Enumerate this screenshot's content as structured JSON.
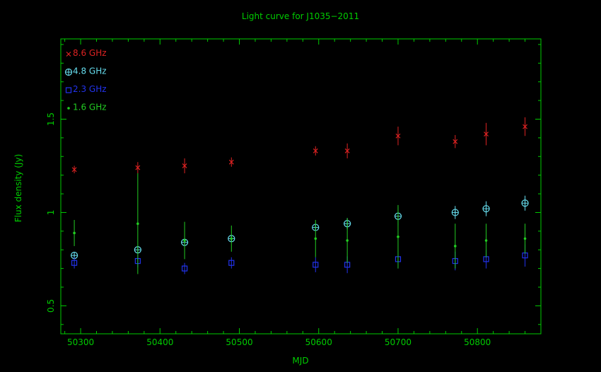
{
  "chart_data": {
    "type": "scatter",
    "title": "Light curve for J1035−2011",
    "xlabel": "MJD",
    "ylabel": "Flux density (Jy)",
    "xlim": [
      50275,
      50880
    ],
    "ylim": [
      0.35,
      1.93
    ],
    "xticks": [
      50300,
      50400,
      50500,
      50600,
      50700,
      50800
    ],
    "xtick_labels": [
      "50300",
      "50400",
      "50500",
      "50600",
      "50700",
      "50800"
    ],
    "yticks": [
      0.5,
      1,
      1.5
    ],
    "ytick_labels": [
      "0.5",
      "1",
      "1.5"
    ],
    "grid": false,
    "legend_position": "top-left",
    "axis_color": "#00cc00",
    "series": [
      {
        "name": "8.6 GHz",
        "marker": "x",
        "color": "#dd2222",
        "points": [
          {
            "x": 50292,
            "y": 1.23,
            "err": 0.02
          },
          {
            "x": 50372,
            "y": 1.24,
            "err": 0.03
          },
          {
            "x": 50431,
            "y": 1.25,
            "err": 0.04
          },
          {
            "x": 50490,
            "y": 1.27,
            "err": 0.025
          },
          {
            "x": 50596,
            "y": 1.33,
            "err": 0.025
          },
          {
            "x": 50636,
            "y": 1.33,
            "err": 0.04
          },
          {
            "x": 50700,
            "y": 1.41,
            "err": 0.05
          },
          {
            "x": 50772,
            "y": 1.38,
            "err": 0.035
          },
          {
            "x": 50811,
            "y": 1.42,
            "err": 0.06
          },
          {
            "x": 50860,
            "y": 1.46,
            "err": 0.05
          }
        ]
      },
      {
        "name": "4.8 GHz",
        "marker": "circle-plus",
        "color": "#66ddee",
        "points": [
          {
            "x": 50292,
            "y": 0.77,
            "err": 0.01
          },
          {
            "x": 50372,
            "y": 0.8,
            "err": 0.02
          },
          {
            "x": 50431,
            "y": 0.84,
            "err": 0.015
          },
          {
            "x": 50490,
            "y": 0.86,
            "err": 0.015
          },
          {
            "x": 50596,
            "y": 0.92,
            "err": 0.015
          },
          {
            "x": 50636,
            "y": 0.94,
            "err": 0.03
          },
          {
            "x": 50700,
            "y": 0.98,
            "err": 0.05
          },
          {
            "x": 50772,
            "y": 1.0,
            "err": 0.035
          },
          {
            "x": 50811,
            "y": 1.02,
            "err": 0.04
          },
          {
            "x": 50860,
            "y": 1.05,
            "err": 0.04
          }
        ]
      },
      {
        "name": "2.3 GHz",
        "marker": "square",
        "color": "#2233ee",
        "points": [
          {
            "x": 50292,
            "y": 0.73,
            "err": 0.03
          },
          {
            "x": 50372,
            "y": 0.74,
            "err": 0.035
          },
          {
            "x": 50431,
            "y": 0.7,
            "err": 0.03
          },
          {
            "x": 50490,
            "y": 0.73,
            "err": 0.03
          },
          {
            "x": 50596,
            "y": 0.72,
            "err": 0.04
          },
          {
            "x": 50636,
            "y": 0.72,
            "err": 0.045
          },
          {
            "x": 50700,
            "y": 0.75,
            "err": 0.05
          },
          {
            "x": 50772,
            "y": 0.74,
            "err": 0.05
          },
          {
            "x": 50811,
            "y": 0.75,
            "err": 0.05
          },
          {
            "x": 50860,
            "y": 0.77,
            "err": 0.06
          }
        ]
      },
      {
        "name": "1.6 GHz",
        "marker": "dot",
        "color": "#22cc22",
        "points": [
          {
            "x": 50292,
            "y": 0.89,
            "err": 0.07
          },
          {
            "x": 50372,
            "y": 0.94,
            "err": 0.27
          },
          {
            "x": 50431,
            "y": 0.85,
            "err": 0.1
          },
          {
            "x": 50490,
            "y": 0.86,
            "err": 0.07
          },
          {
            "x": 50596,
            "y": 0.86,
            "err": 0.1
          },
          {
            "x": 50636,
            "y": 0.85,
            "err": 0.12
          },
          {
            "x": 50700,
            "y": 0.87,
            "err": 0.17
          },
          {
            "x": 50772,
            "y": 0.82,
            "err": 0.12
          },
          {
            "x": 50811,
            "y": 0.85,
            "err": 0.09
          },
          {
            "x": 50860,
            "y": 0.86,
            "err": 0.08
          }
        ]
      }
    ]
  }
}
